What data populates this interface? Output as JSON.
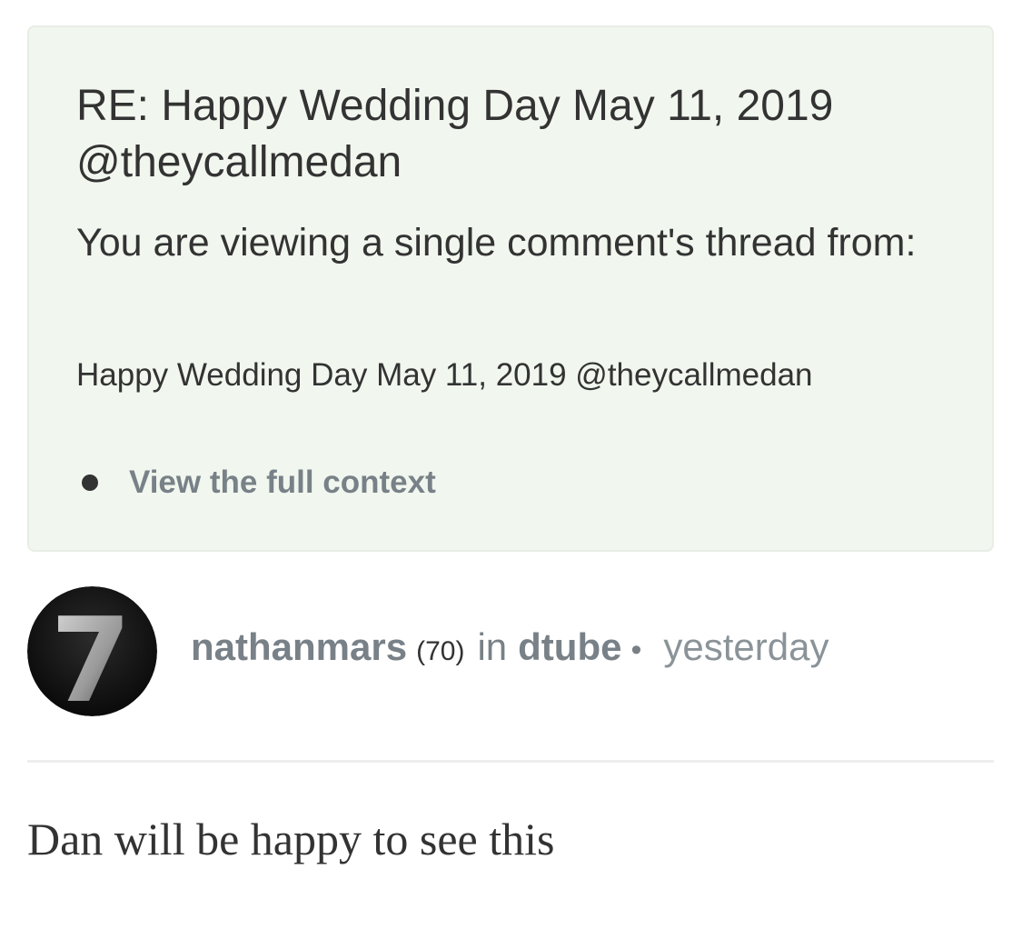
{
  "notice": {
    "title": "RE: Happy Wedding Day May 11, 2019 @theycallmedan",
    "subtitle": "You are viewing a single comment's thread from:",
    "parent_post": "Happy Wedding Day May 11, 2019 @theycallmedan",
    "context_link": "View the full context"
  },
  "comment": {
    "avatar_text": "7",
    "author": "nathanmars",
    "reputation": "(70)",
    "in_label": "in",
    "category": "dtube",
    "separator": "•",
    "timestamp": "yesterday",
    "body": "Dan will be happy to see this"
  },
  "colors": {
    "notice_background": "#f1f7ef",
    "muted_text": "#788187",
    "body_text": "#333333"
  }
}
